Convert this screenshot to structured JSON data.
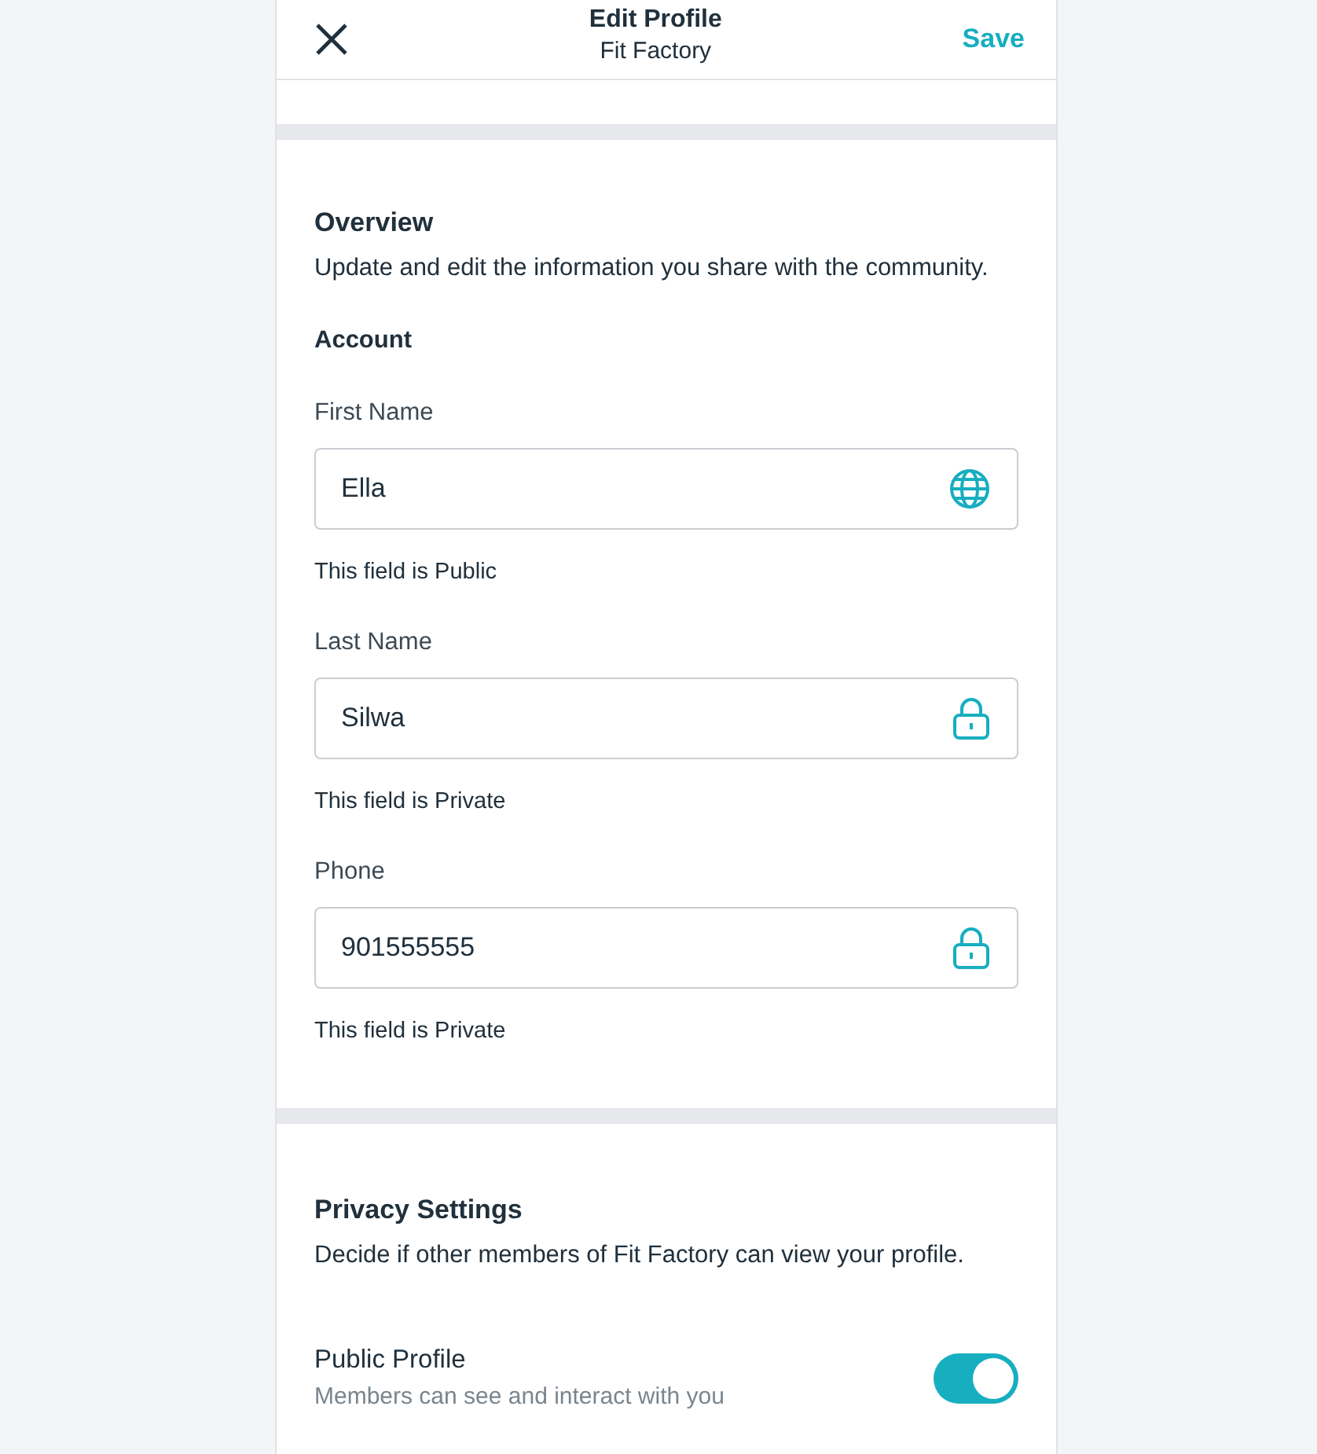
{
  "header": {
    "title": "Edit Profile",
    "subtitle": "Fit Factory",
    "save": "Save"
  },
  "overview": {
    "heading": "Overview",
    "description": "Update and edit the information you share with the community.",
    "subheading": "Account",
    "fields": [
      {
        "label": "First Name",
        "value": "Ella",
        "public": true,
        "note": "This field is Public"
      },
      {
        "label": "Last Name",
        "value": "Silwa",
        "public": false,
        "note": "This field is Private"
      },
      {
        "label": "Phone",
        "value": "901555555",
        "public": false,
        "note": "This field is Private"
      }
    ]
  },
  "privacy": {
    "heading": "Privacy Settings",
    "description": "Decide if other members of Fit Factory can view your profile.",
    "toggles": [
      {
        "label": "Public Profile",
        "hint": "Members can see and interact with you",
        "on": true
      }
    ]
  }
}
